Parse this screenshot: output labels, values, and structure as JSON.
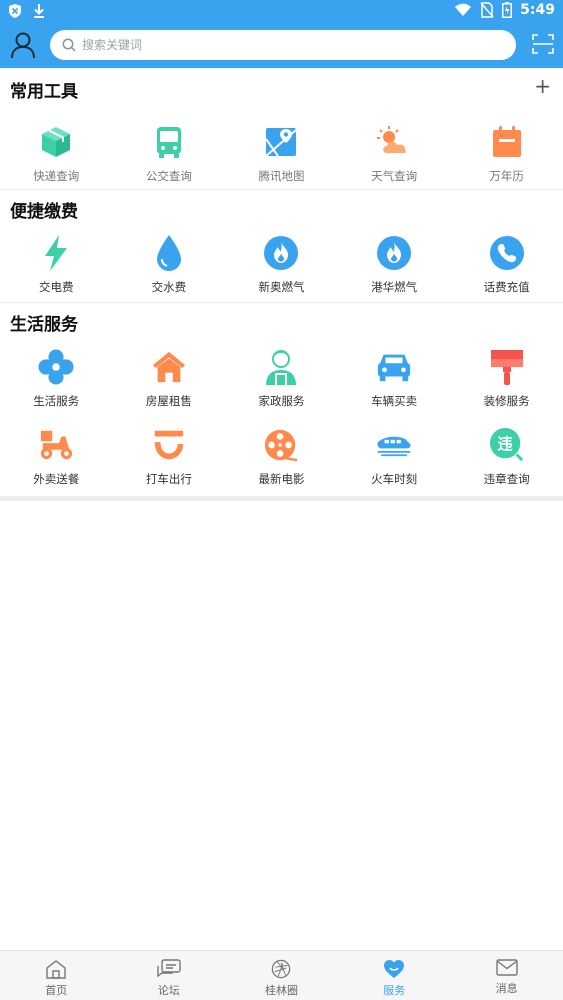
{
  "status_bar": {
    "time": "5:49"
  },
  "search": {
    "placeholder": "搜索关键词"
  },
  "sections": {
    "common_tools": {
      "title": "常用工具",
      "add_label": "+",
      "items": [
        "快递查询",
        "公交查询",
        "腾讯地图",
        "天气查询",
        "万年历"
      ]
    },
    "payments": {
      "title": "便捷缴费",
      "items": [
        "交电费",
        "交水费",
        "新奥燃气",
        "港华燃气",
        "话费充值"
      ]
    },
    "life_services": {
      "title": "生活服务",
      "items": [
        "生活服务",
        "房屋租售",
        "家政服务",
        "车辆买卖",
        "装修服务",
        "外卖送餐",
        "打车出行",
        "最新电影",
        "火车时刻",
        "违章查询"
      ]
    }
  },
  "icons": {
    "common_tools": [
      "package-icon",
      "bus-icon",
      "map-icon",
      "weather-icon",
      "calendar-icon"
    ],
    "payments": [
      "lightning-icon",
      "water-drop-icon",
      "gas-flame-icon",
      "gas-flame-icon",
      "phone-icon"
    ],
    "life_services": [
      "fan-icon",
      "house-icon",
      "housekeeper-icon",
      "car-icon",
      "paint-brush-icon",
      "scooter-icon",
      "taxi-icon",
      "film-reel-icon",
      "train-icon",
      "violation-icon"
    ]
  },
  "tabbar": {
    "items": [
      "首页",
      "论坛",
      "桂林圈",
      "服务",
      "消息"
    ],
    "active": "服务"
  },
  "colors": {
    "primary": "#3aa3f0",
    "teal": "#3dcfa8",
    "orange": "#ff8a4c",
    "blue": "#3aa3f0",
    "red": "#f2564d"
  }
}
